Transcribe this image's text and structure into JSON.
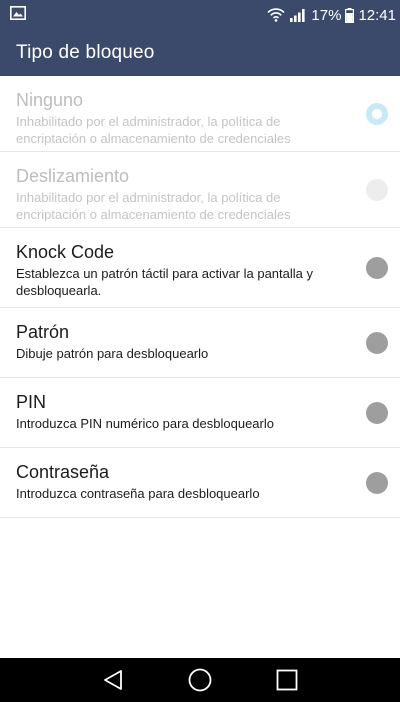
{
  "status_bar": {
    "battery_percent": "17%",
    "time": "12:41"
  },
  "app_bar": {
    "title": "Tipo de bloqueo"
  },
  "lock_options": [
    {
      "title": "Ninguno",
      "description": "Inhabilitado por el administrador, la política de encriptación o almacenamiento de credenciales",
      "enabled": false,
      "selected": true
    },
    {
      "title": "Deslizamiento",
      "description": "Inhabilitado por el administrador, la política de encriptación o almacenamiento de credenciales",
      "enabled": false,
      "selected": false
    },
    {
      "title": "Knock Code",
      "description": "Establezca un patrón táctil para activar la pantalla y desbloquearla.",
      "enabled": true,
      "selected": false
    },
    {
      "title": "Patrón",
      "description": "Dibuje patrón para desbloquearlo",
      "enabled": true,
      "selected": false
    },
    {
      "title": "PIN",
      "description": "Introduzca PIN numérico para desbloquearlo",
      "enabled": true,
      "selected": false
    },
    {
      "title": "Contraseña",
      "description": "Introduzca contraseña para desbloquearlo",
      "enabled": true,
      "selected": false
    }
  ],
  "nav_bar": {
    "icons": [
      "back-icon",
      "home-icon",
      "recents-icon"
    ]
  },
  "colors": {
    "app_bar": "#3b4a6b",
    "text_primary": "#1c1c1c",
    "text_disabled": "#bdbdbd",
    "radio": "#9e9e9e",
    "radio_selected_ring": "#c9eaf4",
    "nav_bar": "#000000"
  }
}
